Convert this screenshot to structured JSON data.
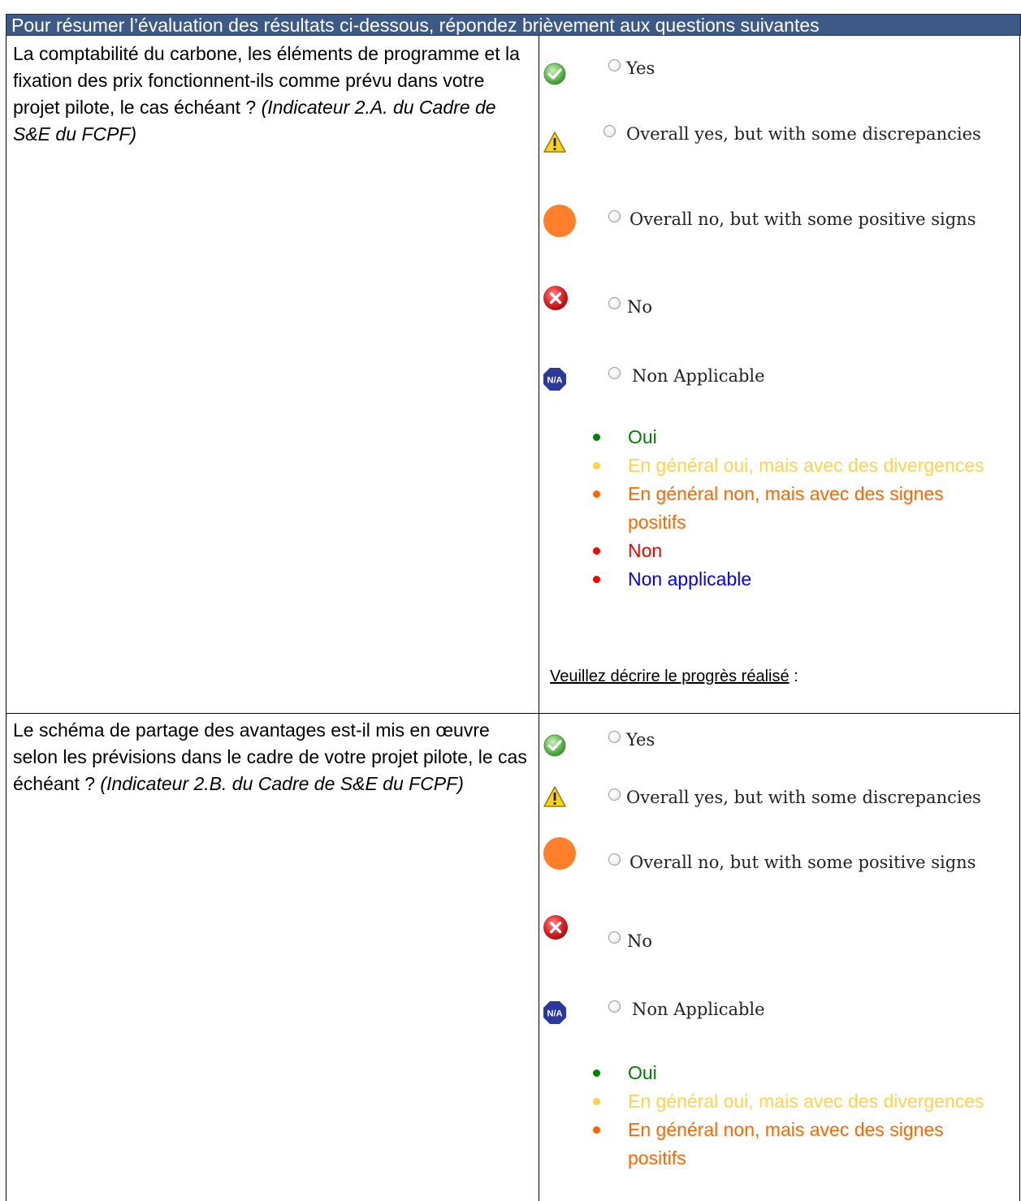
{
  "header": {
    "title": "Pour résumer l’évaluation des résultats ci-dessous, répondez brièvement aux questions suivantes"
  },
  "questions": [
    {
      "text": "La comptabilité du carbone, les éléments de programme et la fixation des prix fonctionnent-ils comme prévu dans votre projet pilote, le cas échéant ? ",
      "indicator": "(Indicateur 2.A. du Cadre de S&E du FCPF)",
      "options": [
        {
          "label": "Yes",
          "icon": "check-icon"
        },
        {
          "label": "Overall yes, but with some discrepancies",
          "icon": "warning-icon"
        },
        {
          "label": "Overall no, but with some positive signs",
          "icon": "orange-circle-icon"
        },
        {
          "label": "No",
          "icon": "error-icon"
        },
        {
          "label": "Non Applicable",
          "icon": "na-icon",
          "icon_text": "N/A"
        }
      ],
      "legend": [
        {
          "label": "Oui",
          "color": "#008000"
        },
        {
          "label": "En général oui, mais avec des divergences",
          "color": "#ffd24d"
        },
        {
          "label": "En général non, mais avec des signes positifs",
          "color": "#ff6600"
        },
        {
          "label": "Non",
          "color": "#ff0000"
        },
        {
          "label": "Non applicable",
          "color": "#0000ff",
          "dot_color": "#ff0000"
        }
      ],
      "progress_label": "Veuillez décrire le progrès réalisé",
      "progress_colon": " :"
    },
    {
      "text": "Le schéma de partage des avantages est-il mis en œuvre selon les prévisions dans le cadre de votre projet pilote, le cas échéant ? ",
      "indicator": "(Indicateur 2.B. du Cadre de S&E du FCPF)",
      "options": [
        {
          "label": "Yes",
          "icon": "check-icon"
        },
        {
          "label": "Overall yes, but with some discrepancies",
          "icon": "warning-icon"
        },
        {
          "label": "Overall no, but with some positive signs",
          "icon": "orange-circle-icon"
        },
        {
          "label": "No",
          "icon": "error-icon"
        },
        {
          "label": "Non Applicable",
          "icon": "na-icon",
          "icon_text": "N/A"
        }
      ],
      "legend": [
        {
          "label": "Oui",
          "color": "#008000"
        },
        {
          "label": "En général oui, mais avec des divergences",
          "color": "#ffd24d"
        },
        {
          "label": "En général non, mais avec des signes positifs",
          "color": "#ff6600"
        }
      ]
    }
  ]
}
